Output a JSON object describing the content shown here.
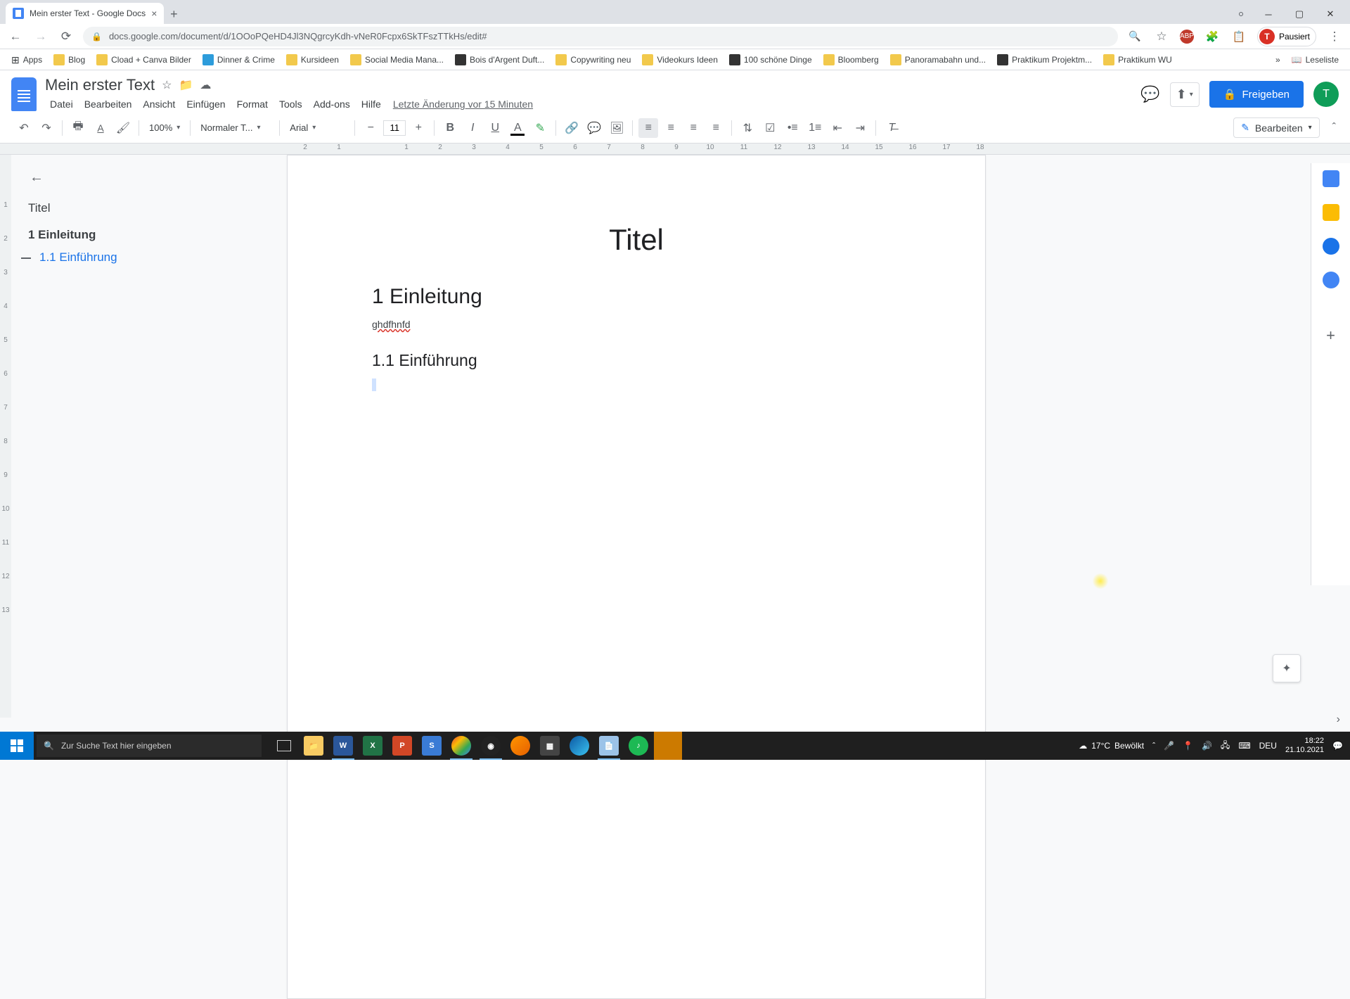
{
  "browser": {
    "tab_title": "Mein erster Text - Google Docs",
    "url": "docs.google.com/document/d/1OOoPQeHD4Jl3NQgrcyKdh-vNeR0Fcpx6SkTFszTTkHs/edit#",
    "profile_status": "Pausiert",
    "profile_initial": "T"
  },
  "bookmarks": [
    {
      "label": "Apps",
      "color": "#5f6368"
    },
    {
      "label": "Blog",
      "color": "#f2c94c"
    },
    {
      "label": "Cload + Canva Bilder",
      "color": "#f2c94c"
    },
    {
      "label": "Dinner & Crime",
      "color": "#2d9cdb"
    },
    {
      "label": "Kursideen",
      "color": "#f2c94c"
    },
    {
      "label": "Social Media Mana...",
      "color": "#f2c94c"
    },
    {
      "label": "Bois d'Argent Duft...",
      "color": "#333"
    },
    {
      "label": "Copywriting neu",
      "color": "#f2c94c"
    },
    {
      "label": "Videokurs Ideen",
      "color": "#f2c94c"
    },
    {
      "label": "100 schöne Dinge",
      "color": "#333"
    },
    {
      "label": "Bloomberg",
      "color": "#f2c94c"
    },
    {
      "label": "Panoramabahn und...",
      "color": "#f2c94c"
    },
    {
      "label": "Praktikum Projektm...",
      "color": "#333"
    },
    {
      "label": "Praktikum WU",
      "color": "#f2c94c"
    }
  ],
  "bookmarks_more": "»",
  "bookmarks_readlist": "Leseliste",
  "docs": {
    "title": "Mein erster Text",
    "menus": [
      "Datei",
      "Bearbeiten",
      "Ansicht",
      "Einfügen",
      "Format",
      "Tools",
      "Add-ons",
      "Hilfe"
    ],
    "last_edit": "Letzte Änderung vor 15 Minuten",
    "share_label": "Freigeben",
    "avatar_initial": "T"
  },
  "toolbar": {
    "zoom": "100%",
    "style": "Normaler T...",
    "font": "Arial",
    "font_size": "11",
    "edit_mode": "Bearbeiten"
  },
  "ruler_numbers": [
    "2",
    "1",
    "",
    "1",
    "2",
    "3",
    "4",
    "5",
    "6",
    "7",
    "8",
    "9",
    "10",
    "11",
    "12",
    "13",
    "14",
    "15",
    "16",
    "17",
    "18"
  ],
  "vruler_numbers": [
    "",
    "1",
    "2",
    "3",
    "4",
    "5",
    "6",
    "7",
    "8",
    "9",
    "10",
    "11",
    "12",
    "13"
  ],
  "outline": {
    "title": "Titel",
    "h1": "1 Einleitung",
    "h2": "1.1 Einführung"
  },
  "document": {
    "title": "Titel",
    "h1": "1 Einleitung",
    "body1": "ghdfhnfd",
    "h2": "1.1 Einführung"
  },
  "taskbar": {
    "search_placeholder": "Zur Suche Text hier eingeben",
    "weather_temp": "17°C",
    "weather_desc": "Bewölkt",
    "lang": "DEU",
    "time": "18:22",
    "date": "21.10.2021"
  }
}
